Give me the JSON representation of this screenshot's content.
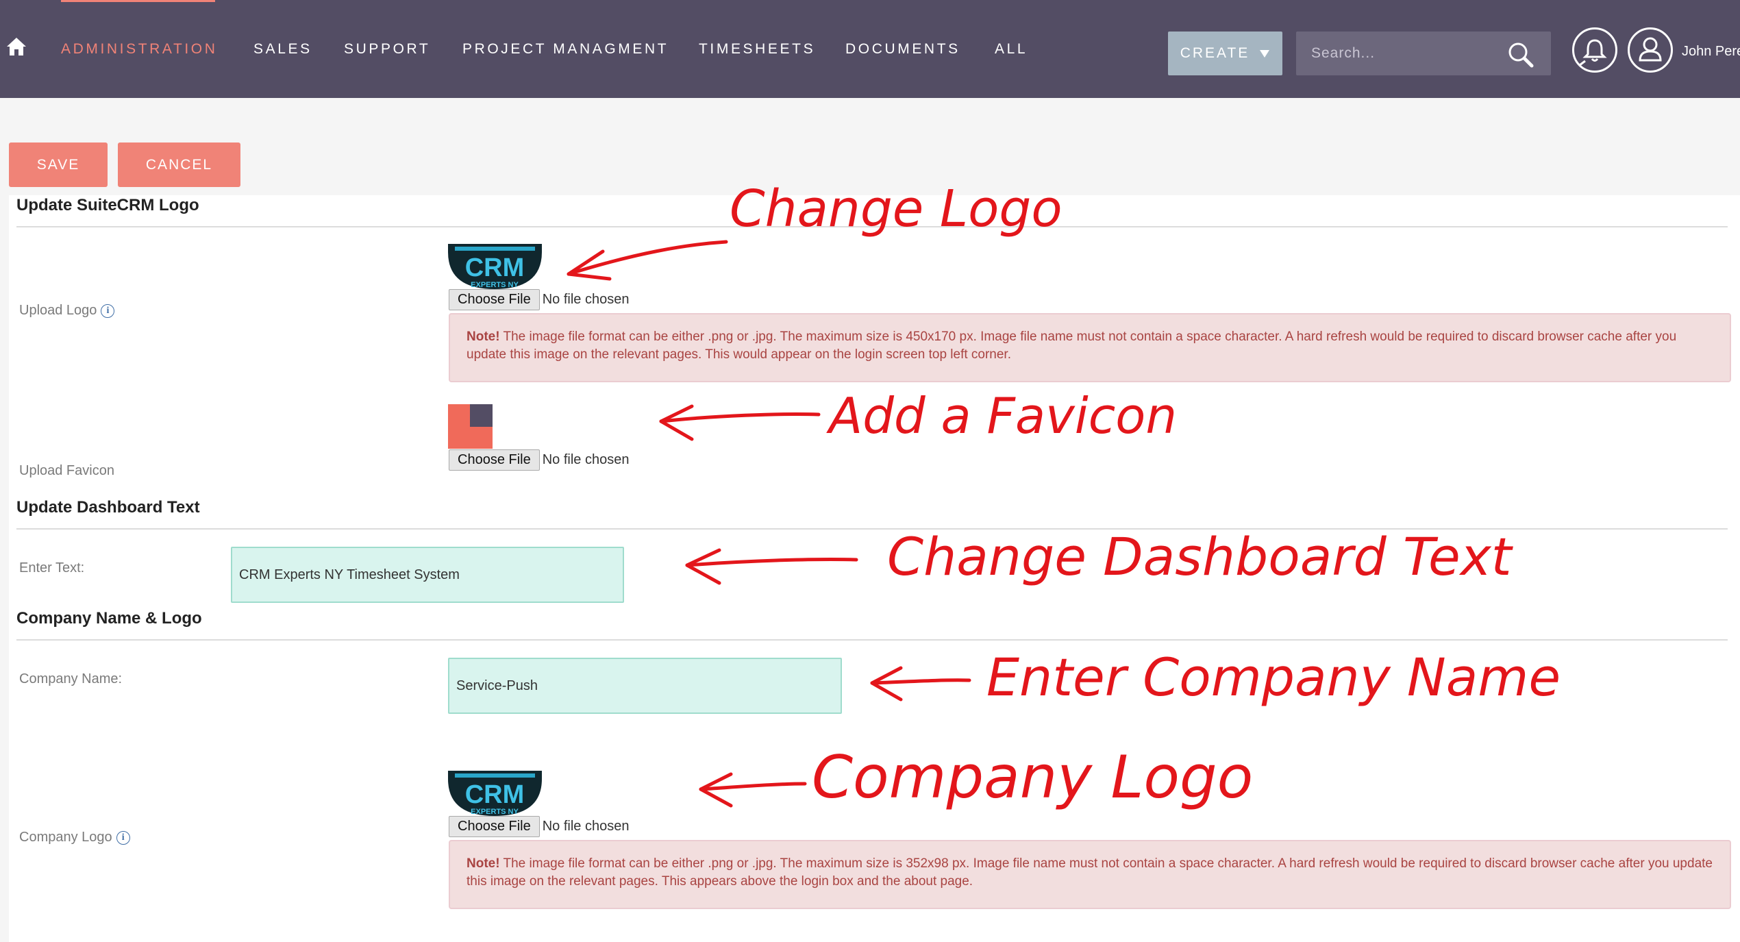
{
  "nav": {
    "items": [
      "ADMINISTRATION",
      "SALES",
      "SUPPORT",
      "PROJECT MANAGMENT",
      "TIMESHEETS",
      "DOCUMENTS",
      "ALL"
    ],
    "create_label": "CREATE",
    "search_placeholder": "Search...",
    "user_name": "John Pere"
  },
  "actions": {
    "save": "SAVE",
    "cancel": "CANCEL"
  },
  "logo_section": {
    "title": "Update SuiteCRM Logo",
    "upload_logo_label": "Upload Logo",
    "upload_favicon_label": "Upload Favicon",
    "logo_note_strong": "Note!",
    "logo_note": "The image file format can be either .png or .jpg. The maximum size is 450x170 px. Image file name must not contain a space character. A hard refresh would be required to discard browser cache after you update this image on the relevant pages. This would appear on the login screen top left corner."
  },
  "file_input": {
    "button": "Choose File",
    "status": "No file chosen"
  },
  "logo_image_text": {
    "main": "CRM",
    "sub": "EXPERTS NY"
  },
  "dashboard_section": {
    "title": "Update Dashboard Text",
    "enter_text_label": "Enter Text:",
    "enter_text_value": "CRM Experts NY Timesheet System"
  },
  "company_section": {
    "title": "Company Name & Logo",
    "company_name_label": "Company Name:",
    "company_name_value": "Service-Push",
    "company_logo_label": "Company Logo",
    "company_note_strong": "Note!",
    "company_note": "The image file format can be either .png or .jpg. The maximum size is 352x98 px. Image file name must not contain a space character. A hard refresh would be required to discard browser cache after you update this image on the relevant pages. This appears above the login box and the about page."
  },
  "annotations": {
    "change_logo": "Change Logo",
    "add_favicon": "Add a Favicon",
    "change_dashboard_text": "Change Dashboard Text",
    "enter_company_name": "Enter Company Name",
    "company_logo": "Company Logo"
  },
  "colors": {
    "nav_bg": "#534d64",
    "accent": "#f08377",
    "input_bg": "#d9f4ee",
    "note_bg": "#f2dede",
    "annotation": "#e3161b"
  }
}
